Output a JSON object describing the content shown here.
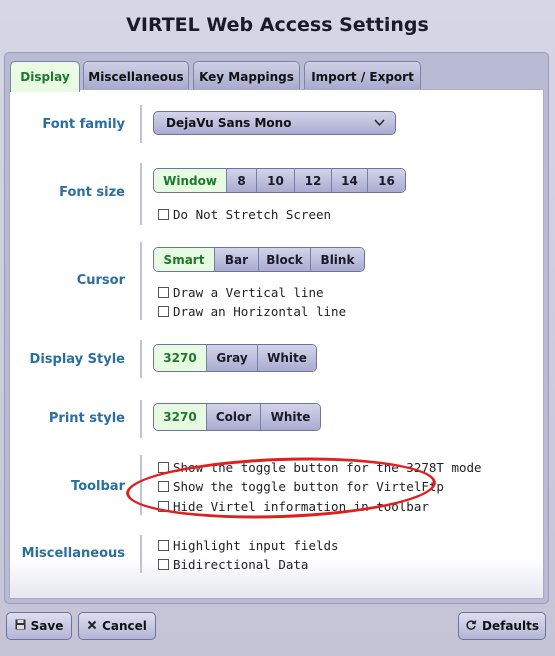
{
  "window": {
    "title": "VIRTEL Web Access Settings"
  },
  "tabs": [
    {
      "label": "Display",
      "active": true
    },
    {
      "label": "Miscellaneous",
      "active": false
    },
    {
      "label": "Key Mappings",
      "active": false
    },
    {
      "label": "Import / Export",
      "active": false
    }
  ],
  "font_family": {
    "label": "Font family",
    "value": "DejaVu Sans Mono"
  },
  "font_size": {
    "label": "Font size",
    "options": [
      "Window",
      "8",
      "10",
      "12",
      "14",
      "16"
    ],
    "selected": "Window",
    "no_stretch": {
      "label": "Do Not Stretch Screen",
      "checked": false
    }
  },
  "cursor": {
    "label": "Cursor",
    "options": [
      "Smart",
      "Bar",
      "Block",
      "Blink"
    ],
    "selected": "Smart",
    "vertical": {
      "label": "Draw a Vertical line",
      "checked": false
    },
    "horizontal": {
      "label": "Draw an Horizontal line",
      "checked": false
    }
  },
  "display_style": {
    "label": "Display Style",
    "options": [
      "3270",
      "Gray",
      "White"
    ],
    "selected": "3270"
  },
  "print_style": {
    "label": "Print style",
    "options": [
      "3270",
      "Color",
      "White"
    ],
    "selected": "3270"
  },
  "toolbar": {
    "label": "Toolbar",
    "items": [
      {
        "label": "Show the toggle button for the 3278T mode",
        "checked": false
      },
      {
        "label": "Show the toggle button for VirtelFtp",
        "checked": false
      },
      {
        "label": "Hide Virtel information in toolbar",
        "checked": false
      }
    ]
  },
  "miscellaneous": {
    "label": "Miscellaneous",
    "items": [
      {
        "label": "Highlight input fields",
        "checked": false
      },
      {
        "label": "Bidirectional Data",
        "checked": false
      }
    ]
  },
  "buttons": {
    "save": "Save",
    "cancel": "Cancel",
    "defaults": "Defaults"
  },
  "annotation": {
    "color": "#e02020"
  },
  "colors": {
    "accent_label": "#2a6f9f",
    "selected_green": "#1d7a2c"
  }
}
